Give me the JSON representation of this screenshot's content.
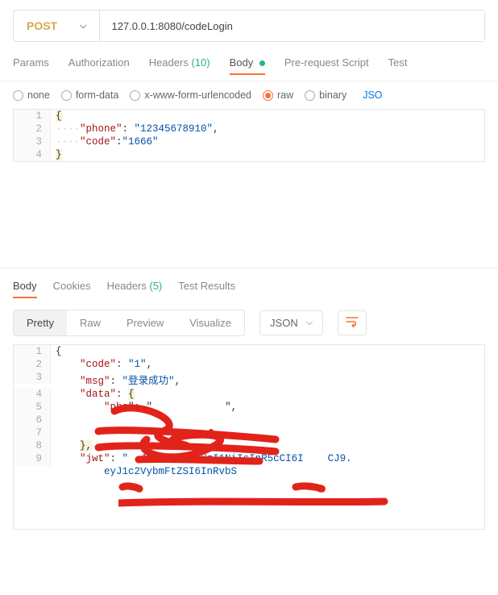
{
  "request": {
    "method": "POST",
    "url": "127.0.0.1:8080/codeLogin"
  },
  "req_tabs": {
    "params": "Params",
    "auth": "Authorization",
    "headers_label": "Headers",
    "headers_count": "(10)",
    "body": "Body",
    "prereq": "Pre-request Script",
    "tests": "Test"
  },
  "body_opts": {
    "none": "none",
    "form": "form-data",
    "xwww": "x-www-form-urlencoded",
    "raw": "raw",
    "binary": "binary",
    "format": "JSO"
  },
  "req_body": {
    "l1": "{",
    "l2_indent": "····",
    "l2_key": "\"phone\"",
    "l2_sep": ": ",
    "l2_val": "\"12345678910\"",
    "l2_end": ",",
    "l3_indent": "····",
    "l3_key": "\"code\"",
    "l3_sep": ":",
    "l3_val": "\"1666\"",
    "l4": "}"
  },
  "resp_tabs": {
    "body": "Body",
    "cookies": "Cookies",
    "headers_label": "Headers",
    "headers_count": "(5)",
    "tests": "Test Results"
  },
  "resp_ctrl": {
    "pretty": "Pretty",
    "raw": "Raw",
    "preview": "Preview",
    "visualize": "Visualize",
    "format": "JSON"
  },
  "resp_body": {
    "l1": "{",
    "l2_key": "\"code\"",
    "l2_val": "\"1\"",
    "l3_key": "\"msg\"",
    "l3_val": "\"登录成功\"",
    "l4_key": "\"data\"",
    "l4_val": "{",
    "l5_key": "\"pho",
    "l5_mid": "\": \"",
    "l5_end": "\",",
    "l8": "},",
    "l9_key": "\"jwt\"",
    "l9_val_a": "JhbGciOiJIUzI1NiIsInR5cCI6I",
    "l9_val_b": "CJ9.",
    "l10": "eyJ1c2VybmFtZSI6InRvbS"
  }
}
